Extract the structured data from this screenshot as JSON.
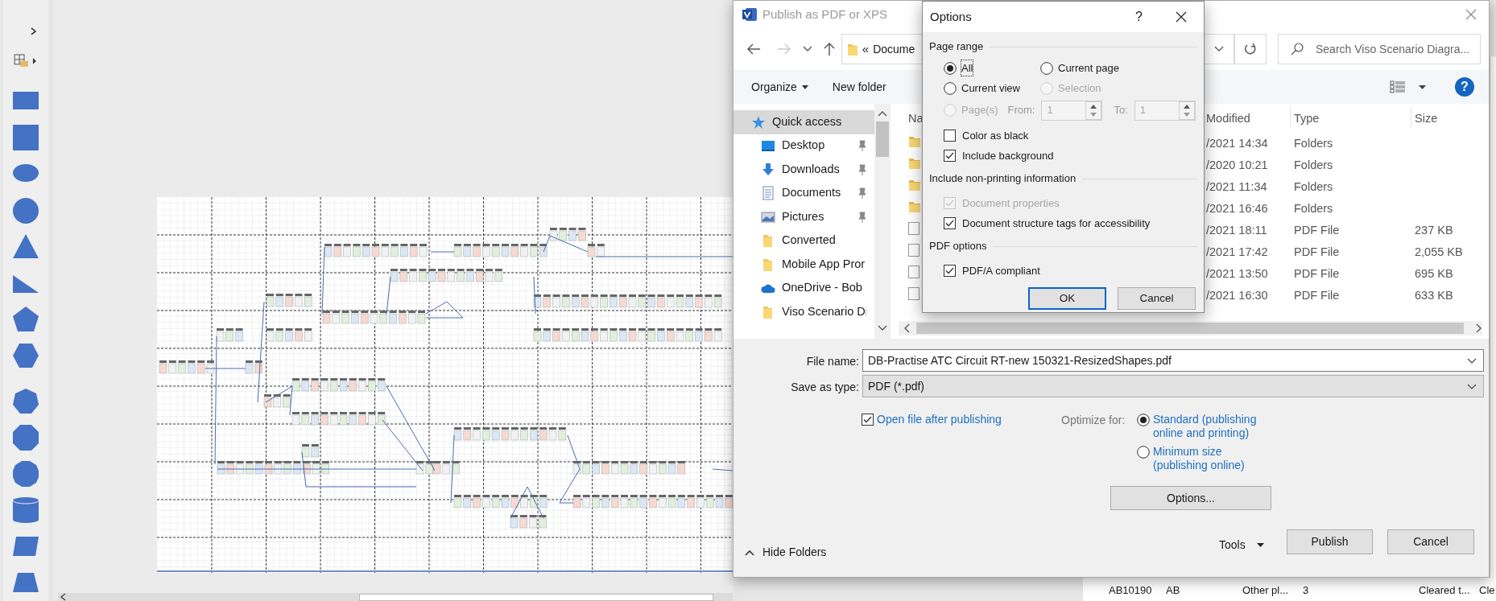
{
  "stencil": {
    "shapes": [
      {
        "kind": "rectangle"
      },
      {
        "kind": "square"
      },
      {
        "kind": "ellipse"
      },
      {
        "kind": "circle"
      },
      {
        "kind": "triangle"
      },
      {
        "kind": "right-triangle"
      },
      {
        "kind": "pentagon"
      },
      {
        "kind": "hexagon"
      },
      {
        "kind": "heptagon"
      },
      {
        "kind": "octagon"
      },
      {
        "kind": "decagon"
      },
      {
        "kind": "cylinder"
      },
      {
        "kind": "parallelogram"
      },
      {
        "kind": "trapezoid"
      }
    ]
  },
  "publish_dialog": {
    "title": "Publish as PDF or XPS",
    "address": {
      "prefix": "«",
      "path": "Docume"
    },
    "search": {
      "placeholder": "Search Viso Scenario Diagra..."
    },
    "toolbar": {
      "organize": "Organize",
      "new_folder": "New folder",
      "help": "?"
    },
    "nav_pane": [
      {
        "label": "Quick access",
        "kind": "star",
        "pinned": false,
        "selected": true
      },
      {
        "label": "Desktop",
        "kind": "desktop",
        "pinned": true,
        "selected": false
      },
      {
        "label": "Downloads",
        "kind": "download",
        "pinned": true,
        "selected": false
      },
      {
        "label": "Documents",
        "kind": "documents",
        "pinned": true,
        "selected": false
      },
      {
        "label": "Pictures",
        "kind": "pictures",
        "pinned": true,
        "selected": false
      },
      {
        "label": "Converted",
        "kind": "folder",
        "pinned": false,
        "selected": false
      },
      {
        "label": "Mobile App Pror",
        "kind": "folder",
        "pinned": false,
        "selected": false
      },
      {
        "label": "OneDrive - Bob",
        "kind": "cloud",
        "pinned": false,
        "selected": false
      },
      {
        "label": "Viso Scenario Di",
        "kind": "folder",
        "pinned": false,
        "selected": false
      }
    ],
    "columns": [
      "Na",
      "Modified",
      "Type",
      "Size"
    ],
    "rows": [
      {
        "kind": "folder",
        "modified": "/2021 14:34",
        "type": "Folders"
      },
      {
        "kind": "folder",
        "modified": "/2020 10:21",
        "type": "Folders"
      },
      {
        "kind": "folder",
        "modified": "/2021 11:34",
        "type": "Folders"
      },
      {
        "kind": "folder",
        "modified": "/2021 16:46",
        "type": "Folders"
      },
      {
        "kind": "pdf",
        "modified": "/2021 18:11",
        "type": "PDF File",
        "size": "237 KB"
      },
      {
        "kind": "pdf",
        "modified": "/2021 17:42",
        "type": "PDF File",
        "size": "2,055 KB"
      },
      {
        "kind": "pdf",
        "modified": "/2021 13:50",
        "type": "PDF File",
        "size": "695 KB"
      },
      {
        "kind": "pdf",
        "modified": "/2021 16:30",
        "type": "PDF File",
        "size": "633 KB"
      }
    ],
    "file_name": {
      "label": "File name:",
      "value": "DB-Practise ATC Circuit RT-new 150321-ResizedShapes.pdf"
    },
    "save_as_type": {
      "label": "Save as type:",
      "value": "PDF (*.pdf)"
    },
    "open_after": {
      "label": "Open file after publishing",
      "checked": true
    },
    "optimize": {
      "label": "Optimize for:",
      "options": [
        {
          "label": "Standard (publishing online and printing)",
          "selected": true
        },
        {
          "label": "Minimum size (publishing online)",
          "selected": false
        }
      ]
    },
    "options_button": "Options...",
    "hide_folders": "Hide Folders",
    "tools": "Tools",
    "publish": "Publish",
    "cancel": "Cancel"
  },
  "options_dialog": {
    "title": "Options",
    "help": "?",
    "page_range": {
      "heading": "Page range",
      "choices": [
        {
          "label": "All",
          "selected": true,
          "disabled": false
        },
        {
          "label": "Current page",
          "selected": false,
          "disabled": false
        },
        {
          "label": "Current view",
          "selected": false,
          "disabled": false
        },
        {
          "label": "Selection",
          "selected": false,
          "disabled": true
        },
        {
          "label": "Page(s)",
          "selected": false,
          "disabled": true
        }
      ],
      "from": {
        "label": "From:",
        "value": "1"
      },
      "to": {
        "label": "To:",
        "value": "1"
      },
      "checks": [
        {
          "label": "Color as black",
          "checked": false,
          "disabled": false
        },
        {
          "label": "Include background",
          "checked": true,
          "disabled": false
        }
      ]
    },
    "non_printing": {
      "heading": "Include non-printing information",
      "checks": [
        {
          "label": "Document properties",
          "checked": true,
          "disabled": true
        },
        {
          "label": "Document structure tags for accessibility",
          "checked": true,
          "disabled": false
        }
      ]
    },
    "pdf_options": {
      "heading": "PDF options",
      "checks": [
        {
          "label": "PDF/A compliant",
          "checked": true,
          "disabled": false
        }
      ]
    },
    "buttons": [
      {
        "label": "OK",
        "default": true
      },
      {
        "label": "Cancel",
        "default": false
      }
    ]
  },
  "background_sheet": {
    "row": [
      "AB10190",
      "AB",
      "Other pl...",
      "3",
      "Cleared t...",
      "Cle"
    ]
  }
}
